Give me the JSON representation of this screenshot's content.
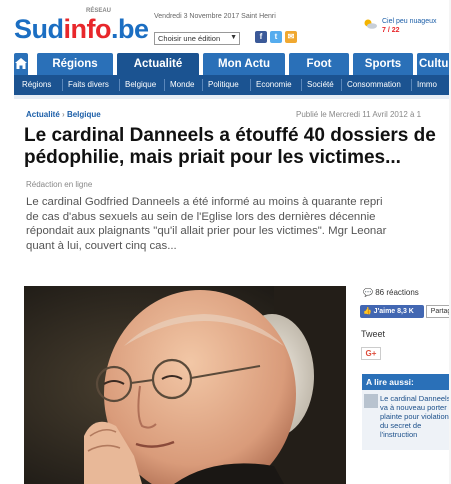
{
  "header": {
    "logo": {
      "sud": "Sud",
      "info": "info",
      "be": ".be"
    },
    "logo_tagline": "RÉSEAU",
    "date": "Vendredi 3 Novembre 2017 Saint Henri",
    "edition_select": "Choisir une édition",
    "social": {
      "facebook": "f",
      "twitter": "t",
      "mail": "✉"
    },
    "weather": {
      "condition": "Ciel peu nuageux",
      "low": "7",
      "high": "22",
      "separator": " / "
    }
  },
  "nav": {
    "tabs": [
      "Régions",
      "Actualité",
      "Mon Actu",
      "Foot",
      "Sports",
      "Culture"
    ],
    "active_tab": "Actualité",
    "subnav": [
      "Régions",
      "Faits divers",
      "Belgique",
      "Monde",
      "Politique",
      "Economie",
      "Société",
      "Consommation",
      "Immo"
    ]
  },
  "article": {
    "breadcrumb": {
      "section": "Actualité",
      "sep": "›",
      "subsection": "Belgique"
    },
    "published": "Publié le Mercredi 11 Avril 2012 à 1",
    "title_line1": "Le cardinal Danneels a étouffé 40 dossiers de",
    "title_line2": "pédophilie, mais priait pour les victimes...",
    "author": "Rédaction en ligne",
    "lead_lines": [
      "Le cardinal Godfried Danneels a été informé au moins à quarante repri",
      "de cas d'abus sexuels au sein de l'Eglise lors des dernières décennie",
      "répondait aux plaignants \"qu'il allait prier pour les victimes\". Mgr Leonar",
      "quant à lui, couvert cinq cas..."
    ]
  },
  "sidebar": {
    "reactions": "86 réactions",
    "like_label": "J'aime 8,3 K",
    "like_count": "Partag",
    "tweet": "Tweet",
    "gplus": "G+",
    "also_read_title": "A lire aussi:",
    "also_read_text": "Le cardinal Danneels va à nouveau porter plainte pour violation du secret de l'instruction"
  },
  "colors": {
    "brand_blue": "#1b6ec2",
    "brand_red": "#e8272b",
    "nav_active": "#1b5391"
  }
}
